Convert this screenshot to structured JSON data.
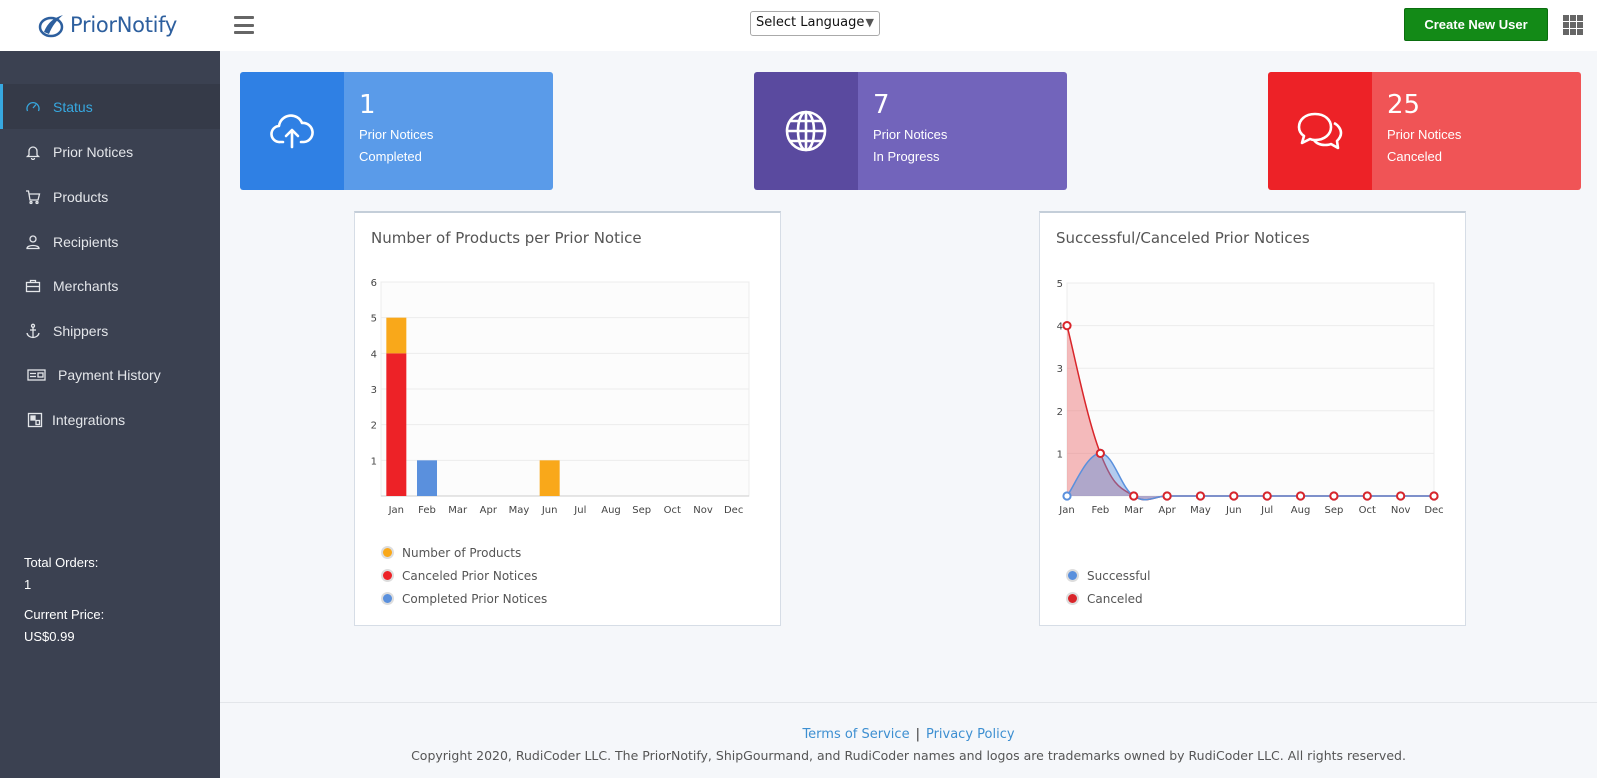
{
  "header": {
    "brand": "PriorNotify",
    "language_label": "Select Language",
    "create_user_label": "Create New User"
  },
  "sidebar": {
    "items": [
      {
        "label": "Status",
        "icon": "gauge-icon",
        "active": true
      },
      {
        "label": "Prior Notices",
        "icon": "bell-icon"
      },
      {
        "label": "Products",
        "icon": "cart-icon"
      },
      {
        "label": "Recipients",
        "icon": "user-icon"
      },
      {
        "label": "Merchants",
        "icon": "briefcase-icon"
      },
      {
        "label": "Shippers",
        "icon": "anchor-icon"
      },
      {
        "label": "Payment History",
        "icon": "receipt-icon"
      },
      {
        "label": "Integrations",
        "icon": "integration-icon"
      }
    ],
    "total_orders_label": "Total Orders:",
    "total_orders_value": "1",
    "current_price_label": "Current Price:",
    "current_price_value": "US$0.99"
  },
  "stats": [
    {
      "number": "1",
      "line1": "Prior Notices",
      "line2": "Completed",
      "icon": "cloud-upload-icon",
      "icon_bg": "#2f80e4",
      "body_bg": "#5a9be9"
    },
    {
      "number": "7",
      "line1": "Prior Notices",
      "line2": "In Progress",
      "icon": "globe-icon",
      "icon_bg": "#5a4a9f",
      "body_bg": "#7264bb"
    },
    {
      "number": "25",
      "line1": "Prior Notices",
      "line2": "Canceled",
      "icon": "chat-icon",
      "icon_bg": "#ed2227",
      "body_bg": "#f05456"
    }
  ],
  "chart_data": [
    {
      "type": "bar",
      "title": "Number of Products per Prior Notice",
      "categories": [
        "Jan",
        "Feb",
        "Mar",
        "Apr",
        "May",
        "Jun",
        "Jul",
        "Aug",
        "Sep",
        "Oct",
        "Nov",
        "Dec"
      ],
      "stacked": true,
      "ylim": [
        0,
        6
      ],
      "yticks": [
        1,
        2,
        3,
        4,
        5,
        6
      ],
      "series": [
        {
          "name": "Number of Products",
          "color": "#f9a81a",
          "values": [
            1,
            0,
            0,
            0,
            0,
            1,
            0,
            0,
            0,
            0,
            0,
            0
          ]
        },
        {
          "name": "Canceled Prior Notices",
          "color": "#ed2227",
          "values": [
            4,
            0,
            0,
            0,
            0,
            0,
            0,
            0,
            0,
            0,
            0,
            0
          ]
        },
        {
          "name": "Completed Prior Notices",
          "color": "#5a90dd",
          "values": [
            0,
            1,
            0,
            0,
            0,
            0,
            0,
            0,
            0,
            0,
            0,
            0
          ]
        }
      ],
      "legend": "bottom-left",
      "grid": true
    },
    {
      "type": "area",
      "title": "Successful/Canceled Prior Notices",
      "categories": [
        "Jan",
        "Feb",
        "Mar",
        "Apr",
        "May",
        "Jun",
        "Jul",
        "Aug",
        "Sep",
        "Oct",
        "Nov",
        "Dec"
      ],
      "ylim": [
        0,
        5
      ],
      "yticks": [
        1,
        2,
        3,
        4,
        5
      ],
      "series": [
        {
          "name": "Successful",
          "color": "#5a90dd",
          "values": [
            0,
            1,
            0,
            0,
            0,
            0,
            0,
            0,
            0,
            0,
            0,
            0
          ]
        },
        {
          "name": "Canceled",
          "color": "#d9252a",
          "values": [
            4,
            1,
            0,
            0,
            0,
            0,
            0,
            0,
            0,
            0,
            0,
            0
          ]
        }
      ],
      "legend": "bottom-left",
      "grid": true
    }
  ],
  "footer": {
    "terms_label": "Terms of Service",
    "privacy_label": "Privacy Policy",
    "separator": "|",
    "copyright": "Copyright 2020, RudiCoder LLC. The PriorNotify, ShipGourmand, and RudiCoder names and logos are trademarks owned by RudiCoder LLC. All rights reserved."
  }
}
